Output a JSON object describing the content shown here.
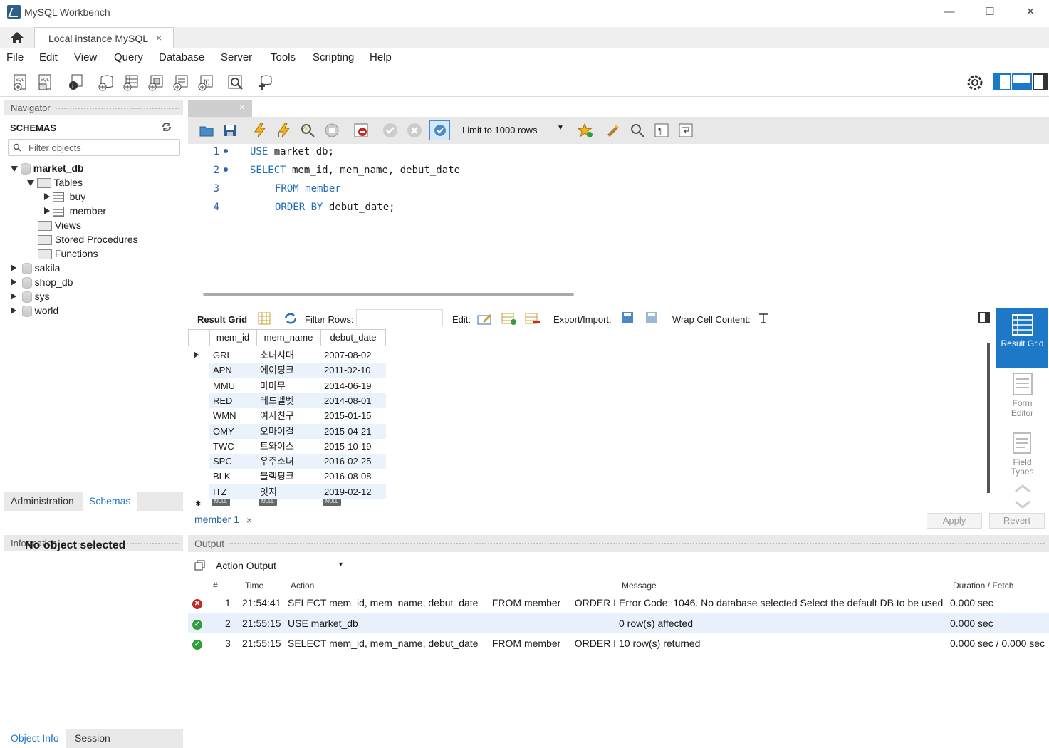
{
  "window": {
    "title": "MySQL Workbench",
    "min": "—",
    "max": "☐",
    "close": "✕"
  },
  "tabs": {
    "instance_label": "Local instance MySQL",
    "close": "×"
  },
  "menu": [
    "File",
    "Edit",
    "View",
    "Query",
    "Database",
    "Server",
    "Tools",
    "Scripting",
    "Help"
  ],
  "navigator": {
    "header": "Navigator",
    "schemas_title": "SCHEMAS",
    "filter_placeholder": "Filter objects",
    "tree": {
      "market_db": "market_db",
      "tables": "Tables",
      "buy": "buy",
      "member": "member",
      "views": "Views",
      "procs": "Stored Procedures",
      "funcs": "Functions",
      "sakila": "sakila",
      "shop_db": "shop_db",
      "sys": "sys",
      "world": "world"
    },
    "tab_admin": "Administration",
    "tab_schemas": "Schemas",
    "info_header": "Information",
    "no_object": "No object selected",
    "tab_objinfo": "Object Info",
    "tab_session": "Session"
  },
  "editor": {
    "limit_label": "Limit to 1000 rows",
    "lines": [
      {
        "n": "1",
        "a": "USE",
        "b": " market_db;"
      },
      {
        "n": "2",
        "a": "SELECT",
        "b": " mem_id, mem_name, debut_date"
      },
      {
        "n": "3",
        "a": "FROM",
        "b": " member"
      },
      {
        "n": "4",
        "a": "ORDER BY",
        "b": " debut_date;"
      }
    ]
  },
  "result": {
    "grid_label": "Result Grid",
    "filter_label": "Filter Rows:",
    "edit_label": "Edit:",
    "export_label": "Export/Import:",
    "wrap_label": "Wrap Cell Content:",
    "columns": [
      "mem_id",
      "mem_name",
      "debut_date"
    ],
    "rows": [
      [
        "GRL",
        "소녀시대",
        "2007-08-02"
      ],
      [
        "APN",
        "에이핑크",
        "2011-02-10"
      ],
      [
        "MMU",
        "마마무",
        "2014-06-19"
      ],
      [
        "RED",
        "레드벨벳",
        "2014-08-01"
      ],
      [
        "WMN",
        "여자친구",
        "2015-01-15"
      ],
      [
        "OMY",
        "오마이걸",
        "2015-04-21"
      ],
      [
        "TWC",
        "트와이스",
        "2015-10-19"
      ],
      [
        "SPC",
        "우주소녀",
        "2016-02-25"
      ],
      [
        "BLK",
        "블랙핑크",
        "2016-08-08"
      ],
      [
        "ITZ",
        "잇지",
        "2019-02-12"
      ]
    ],
    "null_label": "NULL",
    "side": {
      "grid": "Result Grid",
      "form": "Form Editor",
      "field": "Field Types"
    },
    "apply": "Apply",
    "revert": "Revert",
    "tab_label": "member 1",
    "tab_close": "×"
  },
  "output": {
    "header": "Output",
    "selector": "Action Output",
    "columns": {
      "num": "#",
      "time": "Time",
      "action": "Action",
      "message": "Message",
      "duration": "Duration / Fetch"
    },
    "rows": [
      {
        "status": "error",
        "num": "1",
        "time": "21:54:41",
        "action": "SELECT mem_id, mem_name, debut_date     FROM member     ORDER B...",
        "message": "Error Code: 1046. No database selected Select the default DB to be used ...",
        "duration": "0.000 sec"
      },
      {
        "status": "ok",
        "num": "2",
        "time": "21:55:15",
        "action": "USE market_db",
        "message": "0 row(s) affected",
        "duration": "0.000 sec"
      },
      {
        "status": "ok",
        "num": "3",
        "time": "21:55:15",
        "action": "SELECT mem_id, mem_name, debut_date     FROM member     ORDER B...",
        "message": "10 row(s) returned",
        "duration": "0.000 sec / 0.000 sec"
      }
    ]
  },
  "colors": {
    "accent": "#1e78c8",
    "keyword": "#1d6db8",
    "error": "#c62828",
    "ok": "#2e9d3a"
  }
}
